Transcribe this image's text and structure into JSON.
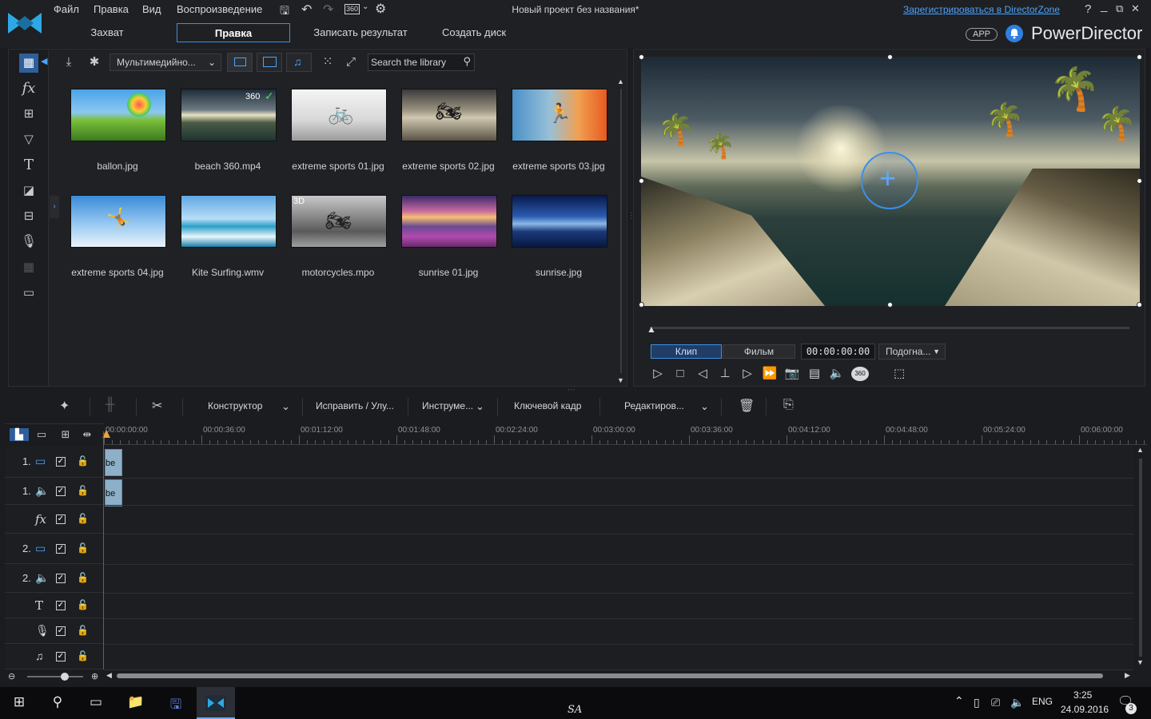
{
  "app": {
    "title": "Новый проект без названия*",
    "brand": "PowerDirector",
    "app_badge": "APP",
    "register_link": "Зарегистрироваться в DirectorZone",
    "help": "?",
    "minimize": "_",
    "restore": "⧉",
    "close": "✕"
  },
  "menu": [
    "Файл",
    "Правка",
    "Вид",
    "Воспроизведение"
  ],
  "toolbar_360": "360",
  "mode_tabs": [
    "Захват",
    "Правка",
    "Записать результат",
    "Создать диск"
  ],
  "library": {
    "dropdown": "Мультимедийно...",
    "search_placeholder": "Search the library",
    "items": [
      {
        "label": "ballon.jpg",
        "badge": ""
      },
      {
        "label": "beach 360.mp4",
        "badge": "360"
      },
      {
        "label": "extreme sports 01.jpg",
        "badge": ""
      },
      {
        "label": "extreme sports 02.jpg",
        "badge": ""
      },
      {
        "label": "extreme sports 03.jpg",
        "badge": ""
      },
      {
        "label": "extreme sports 04.jpg",
        "badge": ""
      },
      {
        "label": "Kite Surfing.wmv",
        "badge": ""
      },
      {
        "label": "motorcycles.mpo",
        "badge": "3D"
      },
      {
        "label": "sunrise 01.jpg",
        "badge": ""
      },
      {
        "label": "sunrise.jpg",
        "badge": ""
      }
    ]
  },
  "preview": {
    "clip_tab": "Клип",
    "movie_tab": "Фильм",
    "timecode": "00:00:00:00",
    "fit": "Подогна...",
    "badge_360": "360"
  },
  "timeline_toolbar": {
    "designer": "Конструктор",
    "fix": "Исправить / Улу...",
    "tools": "Инструме...",
    "keyframe": "Ключевой кадр",
    "edit": "Редактиров..."
  },
  "ruler_marks": [
    "00:00:00:00",
    "00:00:36:00",
    "00:01:12:00",
    "00:01:48:00",
    "00:02:24:00",
    "00:03:00:00",
    "00:03:36:00",
    "00:04:12:00",
    "00:04:48:00",
    "00:05:24:00",
    "00:06:00:00"
  ],
  "tracks": [
    {
      "num": "1.",
      "type": "video"
    },
    {
      "num": "1.",
      "type": "audio"
    },
    {
      "num": "",
      "type": "fx"
    },
    {
      "num": "2.",
      "type": "video"
    },
    {
      "num": "2.",
      "type": "audio"
    },
    {
      "num": "",
      "type": "title"
    },
    {
      "num": "",
      "type": "voice"
    },
    {
      "num": "",
      "type": "music"
    }
  ],
  "clips": {
    "video": "be",
    "audio": "be"
  },
  "taskbar": {
    "lang": "ENG",
    "time": "3:25",
    "date": "24.09.2016",
    "notifications": "3",
    "sa_mark": "SA"
  }
}
